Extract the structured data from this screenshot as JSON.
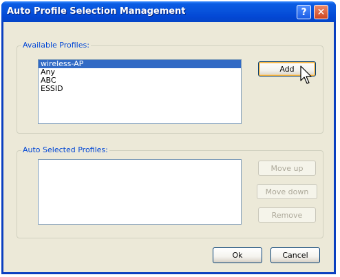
{
  "window": {
    "title": "Auto Profile Selection Management"
  },
  "titlebar": {
    "help_label": "?",
    "close_label": "✕"
  },
  "available": {
    "label": "Available Profiles:",
    "items": [
      "wireless-AP",
      "Any",
      "ABC",
      "ESSID"
    ],
    "selected": "wireless-AP",
    "add_label": "Add"
  },
  "auto": {
    "label": "Auto Selected Profiles:",
    "move_up_label": "Move up",
    "move_down_label": "Move down",
    "remove_label": "Remove"
  },
  "footer": {
    "ok_label": "Ok",
    "cancel_label": "Cancel"
  },
  "colors": {
    "titlebar": "#0553dc",
    "selection": "#316ac5",
    "group_label": "#0046d5",
    "default_button_ring": "#f8b33b"
  }
}
